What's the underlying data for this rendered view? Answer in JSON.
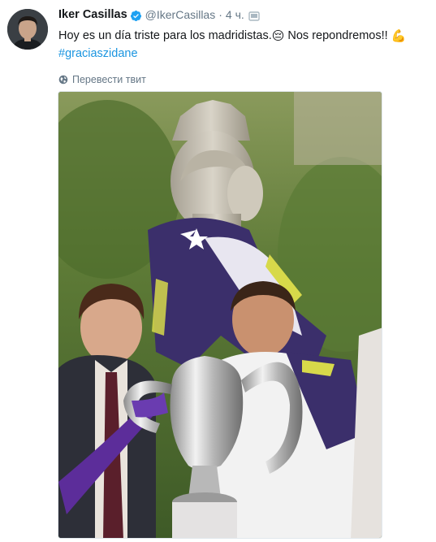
{
  "tweet": {
    "author_name": "Iker Casillas",
    "handle": "@IkerCasillas",
    "separator": "·",
    "time": "4 ч.",
    "text": "Hoy es un día triste para los madridistas.",
    "text_part2": "Nos repondremos!!",
    "emoji_1": "😔",
    "emoji_2": "💪",
    "hashtag": "#graciaszidane",
    "translate_label": "Перевести твит"
  },
  "icons": {
    "verified": "verified-badge-icon",
    "device": "device-icon",
    "translate": "globe-icon"
  },
  "colors": {
    "link": "#1b95e0",
    "secondary_text": "#657786",
    "verified": "#1da1f2"
  }
}
